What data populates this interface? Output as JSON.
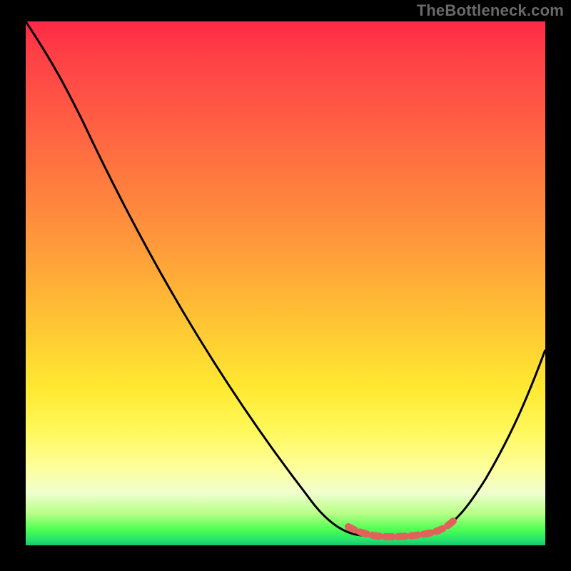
{
  "watermark": "TheBottleneck.com",
  "colors": {
    "background": "#000000",
    "gradient_top": "#ff2846",
    "gradient_mid": "#ffd232",
    "gradient_bottom": "#1bc56e",
    "curve": "#000000",
    "valley_marker": "#e1625a"
  },
  "chart_data": {
    "type": "line",
    "title": "",
    "xlabel": "",
    "ylabel": "",
    "xlim": [
      0,
      100
    ],
    "ylim": [
      0,
      100
    ],
    "grid": false,
    "series": [
      {
        "name": "bottleneck-curve",
        "x": [
          0,
          11,
          22,
          36,
          54,
          65,
          70,
          79,
          82,
          89,
          100
        ],
        "y": [
          100,
          81,
          58,
          33,
          9,
          2,
          2,
          3,
          5,
          13,
          37
        ]
      }
    ],
    "annotations": [
      {
        "name": "valley-region",
        "x_start": 62,
        "x_end": 82,
        "style": "red-dashed"
      }
    ]
  }
}
